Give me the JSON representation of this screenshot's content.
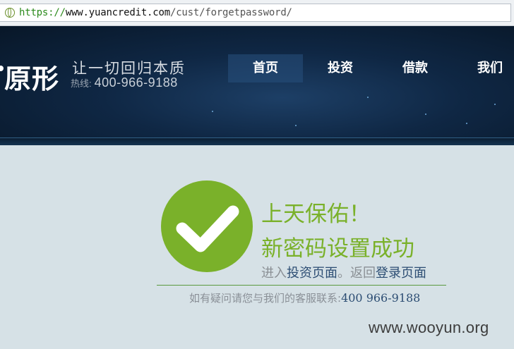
{
  "browser": {
    "url_scheme": "https://",
    "url_host": "www.yuancredit.com",
    "url_path": "/cust/forgetpassword/"
  },
  "header": {
    "logo_text": "原形",
    "slogan": "让一切回归本质",
    "hotline_label": "热线:",
    "hotline_number": "400-966-9188",
    "nav": [
      {
        "label": "首页"
      },
      {
        "label": "投资"
      },
      {
        "label": "借款"
      },
      {
        "label": "我们"
      }
    ]
  },
  "main": {
    "title_line1": "上天保佑！",
    "title_line2": "新密码设置成功",
    "links_prefix": "进入",
    "link_invest": "投资页面",
    "links_middle": "。返回",
    "link_login": "登录页面",
    "contact_text": "如有疑问请您与我们的客服联系:",
    "contact_phone": "400 966-9188"
  },
  "watermark": "www.wooyun.org",
  "colors": {
    "success_green": "#7ab12a",
    "link_blue": "#2c4d73",
    "header_bg": "#0f2744",
    "page_bg": "#d6e1e6"
  },
  "icons": {
    "check": "checkmark-circle-icon",
    "site": "globe-icon"
  }
}
